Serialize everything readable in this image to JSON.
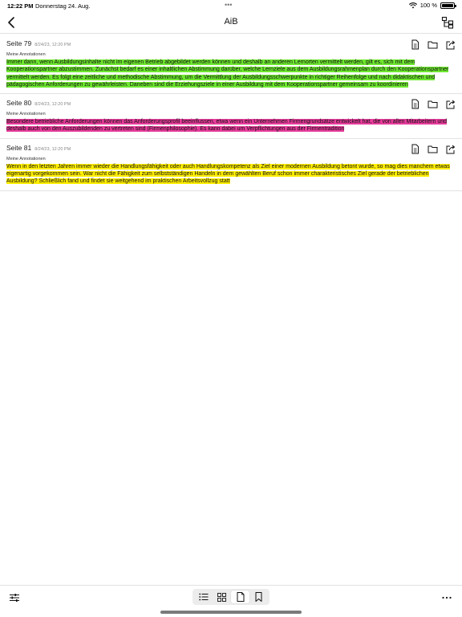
{
  "status_bar": {
    "time": "12:22 PM",
    "date": "Donnerstag 24. Aug.",
    "battery": "100 %"
  },
  "nav": {
    "title": "AiB"
  },
  "annotations": [
    {
      "page": "Seite 79",
      "date": "8/24/23, 12:20 PM",
      "label": "Meine Annotationen",
      "color": "#6ee830",
      "text": "Immer dann, wenn Ausbildungsinhalte nicht im eigenen Betrieb abgebildet werden können und deshalb an anderen Lernorten vermittelt werden, gilt es, sich mit dem Kooperationspartner abzustimmen. Zunächst bedarf es einer inhaltlichen Abstimmung darüber, welche Lernziele aus dem Ausbildungsrahmenplan durch den Kooperationspartner vermittelt werden. Es folgt eine zeitliche und methodische Abstimmung, um die Vermittlung der Ausbildungsschwerpunkte in richtiger Reihenfolge und nach didaktischen und pädagogischen Anforderungen zu gewährleisten. Daneben sind die Erziehungsziele in einer Ausbildung mit dem Kooperationspartner gemeinsam zu koordinieren"
    },
    {
      "page": "Seite 80",
      "date": "8/24/23, 12:20 PM",
      "label": "Meine Annotationen",
      "color": "#e63c9b",
      "text": "Besondere betriebliche Anforderungen können das Anforderungsprofil beeinflussen, etwa wenn ein Unternehmen Firmengrundsätze entwickelt hat, die von allen Mitarbeitern und deshalb auch von den Auszubildenden zu vertreten sind (Firmenphilosophie). Es kann dabei um Verpflichtungen aus der Firmentradition"
    },
    {
      "page": "Seite 81",
      "date": "8/24/23, 12:20 PM",
      "label": "Meine Annotationen",
      "color": "#ffee00",
      "text": "Wenn in den letzten Jahren immer wieder die Handlungsfähigkeit oder auch Handlungskompetenz als Ziel einer modernen Ausbildung betont wurde, so mag dies manchem etwas eigenartig vorgekommen sein. War nicht die Fähigkeit zum selbstständigen Handeln in dem gewählten Beruf schon immer charakteristisches Ziel gerade der betrieblichen Ausbildung? Schließlich fand und findet sie weitgehend im praktischen Arbeitsvollzug statt"
    }
  ],
  "icons": {
    "back": "chevron-left-icon",
    "tree": "hierarchy-icon",
    "doc": "document-icon",
    "folder": "folder-icon",
    "share": "share-icon",
    "filter": "sliders-icon",
    "list": "list-icon",
    "grid": "grid-icon",
    "page": "page-icon",
    "bookmark": "bookmark-icon",
    "more": "ellipsis-icon"
  },
  "toolbar": {
    "active_segment": "page"
  }
}
